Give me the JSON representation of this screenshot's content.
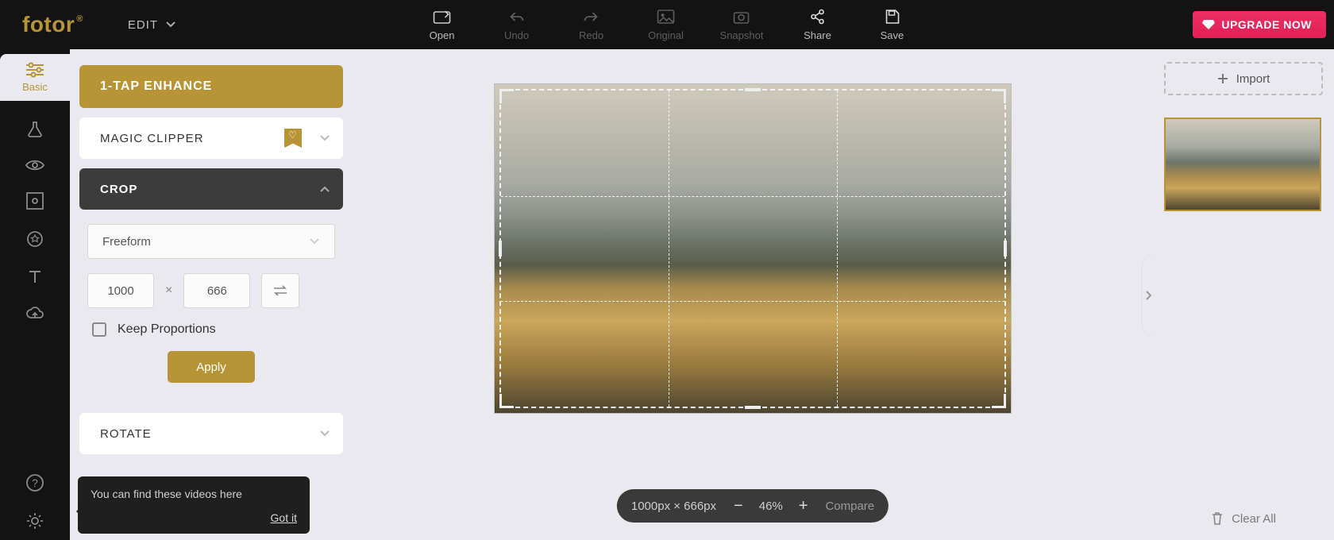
{
  "brand": "fotor",
  "mode": {
    "label": "EDIT"
  },
  "topbar": {
    "open": "Open",
    "undo": "Undo",
    "redo": "Redo",
    "original": "Original",
    "snapshot": "Snapshot",
    "share": "Share",
    "save": "Save"
  },
  "upgrade": "UPGRADE NOW",
  "vtabs": {
    "basic": "Basic"
  },
  "panel": {
    "enhance": "1-TAP ENHANCE",
    "magic_clipper": "MAGIC CLIPPER",
    "crop": "CROP",
    "rotate": "ROTATE",
    "preset_label": "Freeform",
    "width": "1000",
    "height": "666",
    "keep_proportions": "Keep Proportions",
    "apply": "Apply"
  },
  "tooltip": {
    "text": "You can find these videos here",
    "gotit": "Got it"
  },
  "status": {
    "dimensions": "1000px × 666px",
    "zoom": "46%",
    "compare": "Compare"
  },
  "right": {
    "import": "Import",
    "clear_all": "Clear All"
  }
}
